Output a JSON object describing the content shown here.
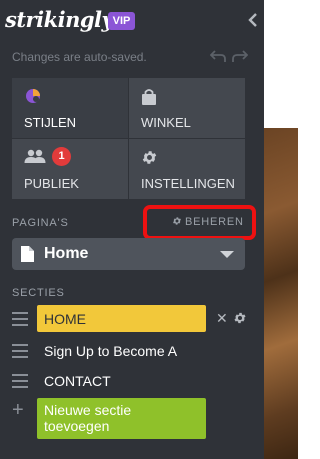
{
  "brand": {
    "logo": "strikingly",
    "plan_badge": "VIP"
  },
  "autosave": "Changes are auto-saved.",
  "tiles": [
    {
      "label": "STIJLEN",
      "icon": "palette-icon"
    },
    {
      "label": "WINKEL",
      "icon": "shopping-bag-icon"
    },
    {
      "label": "PUBLIEK",
      "icon": "people-icon",
      "badge": "1"
    },
    {
      "label": "INSTELLINGEN",
      "icon": "gear-icon"
    }
  ],
  "pages": {
    "label": "PAGINA'S",
    "manage": "BEHEREN",
    "selected": "Home"
  },
  "sections": {
    "label": "SECTIES",
    "items": [
      "HOME",
      "Sign Up to Become A",
      "CONTACT"
    ],
    "add": "Nieuwe sectie toevoegen"
  },
  "colors": {
    "sidebar": "#2f3238",
    "accent_yellow": "#f2c83a",
    "add_green": "#8fc12a",
    "vip_purple": "#8b55d6",
    "highlight_red": "#ee1111"
  }
}
